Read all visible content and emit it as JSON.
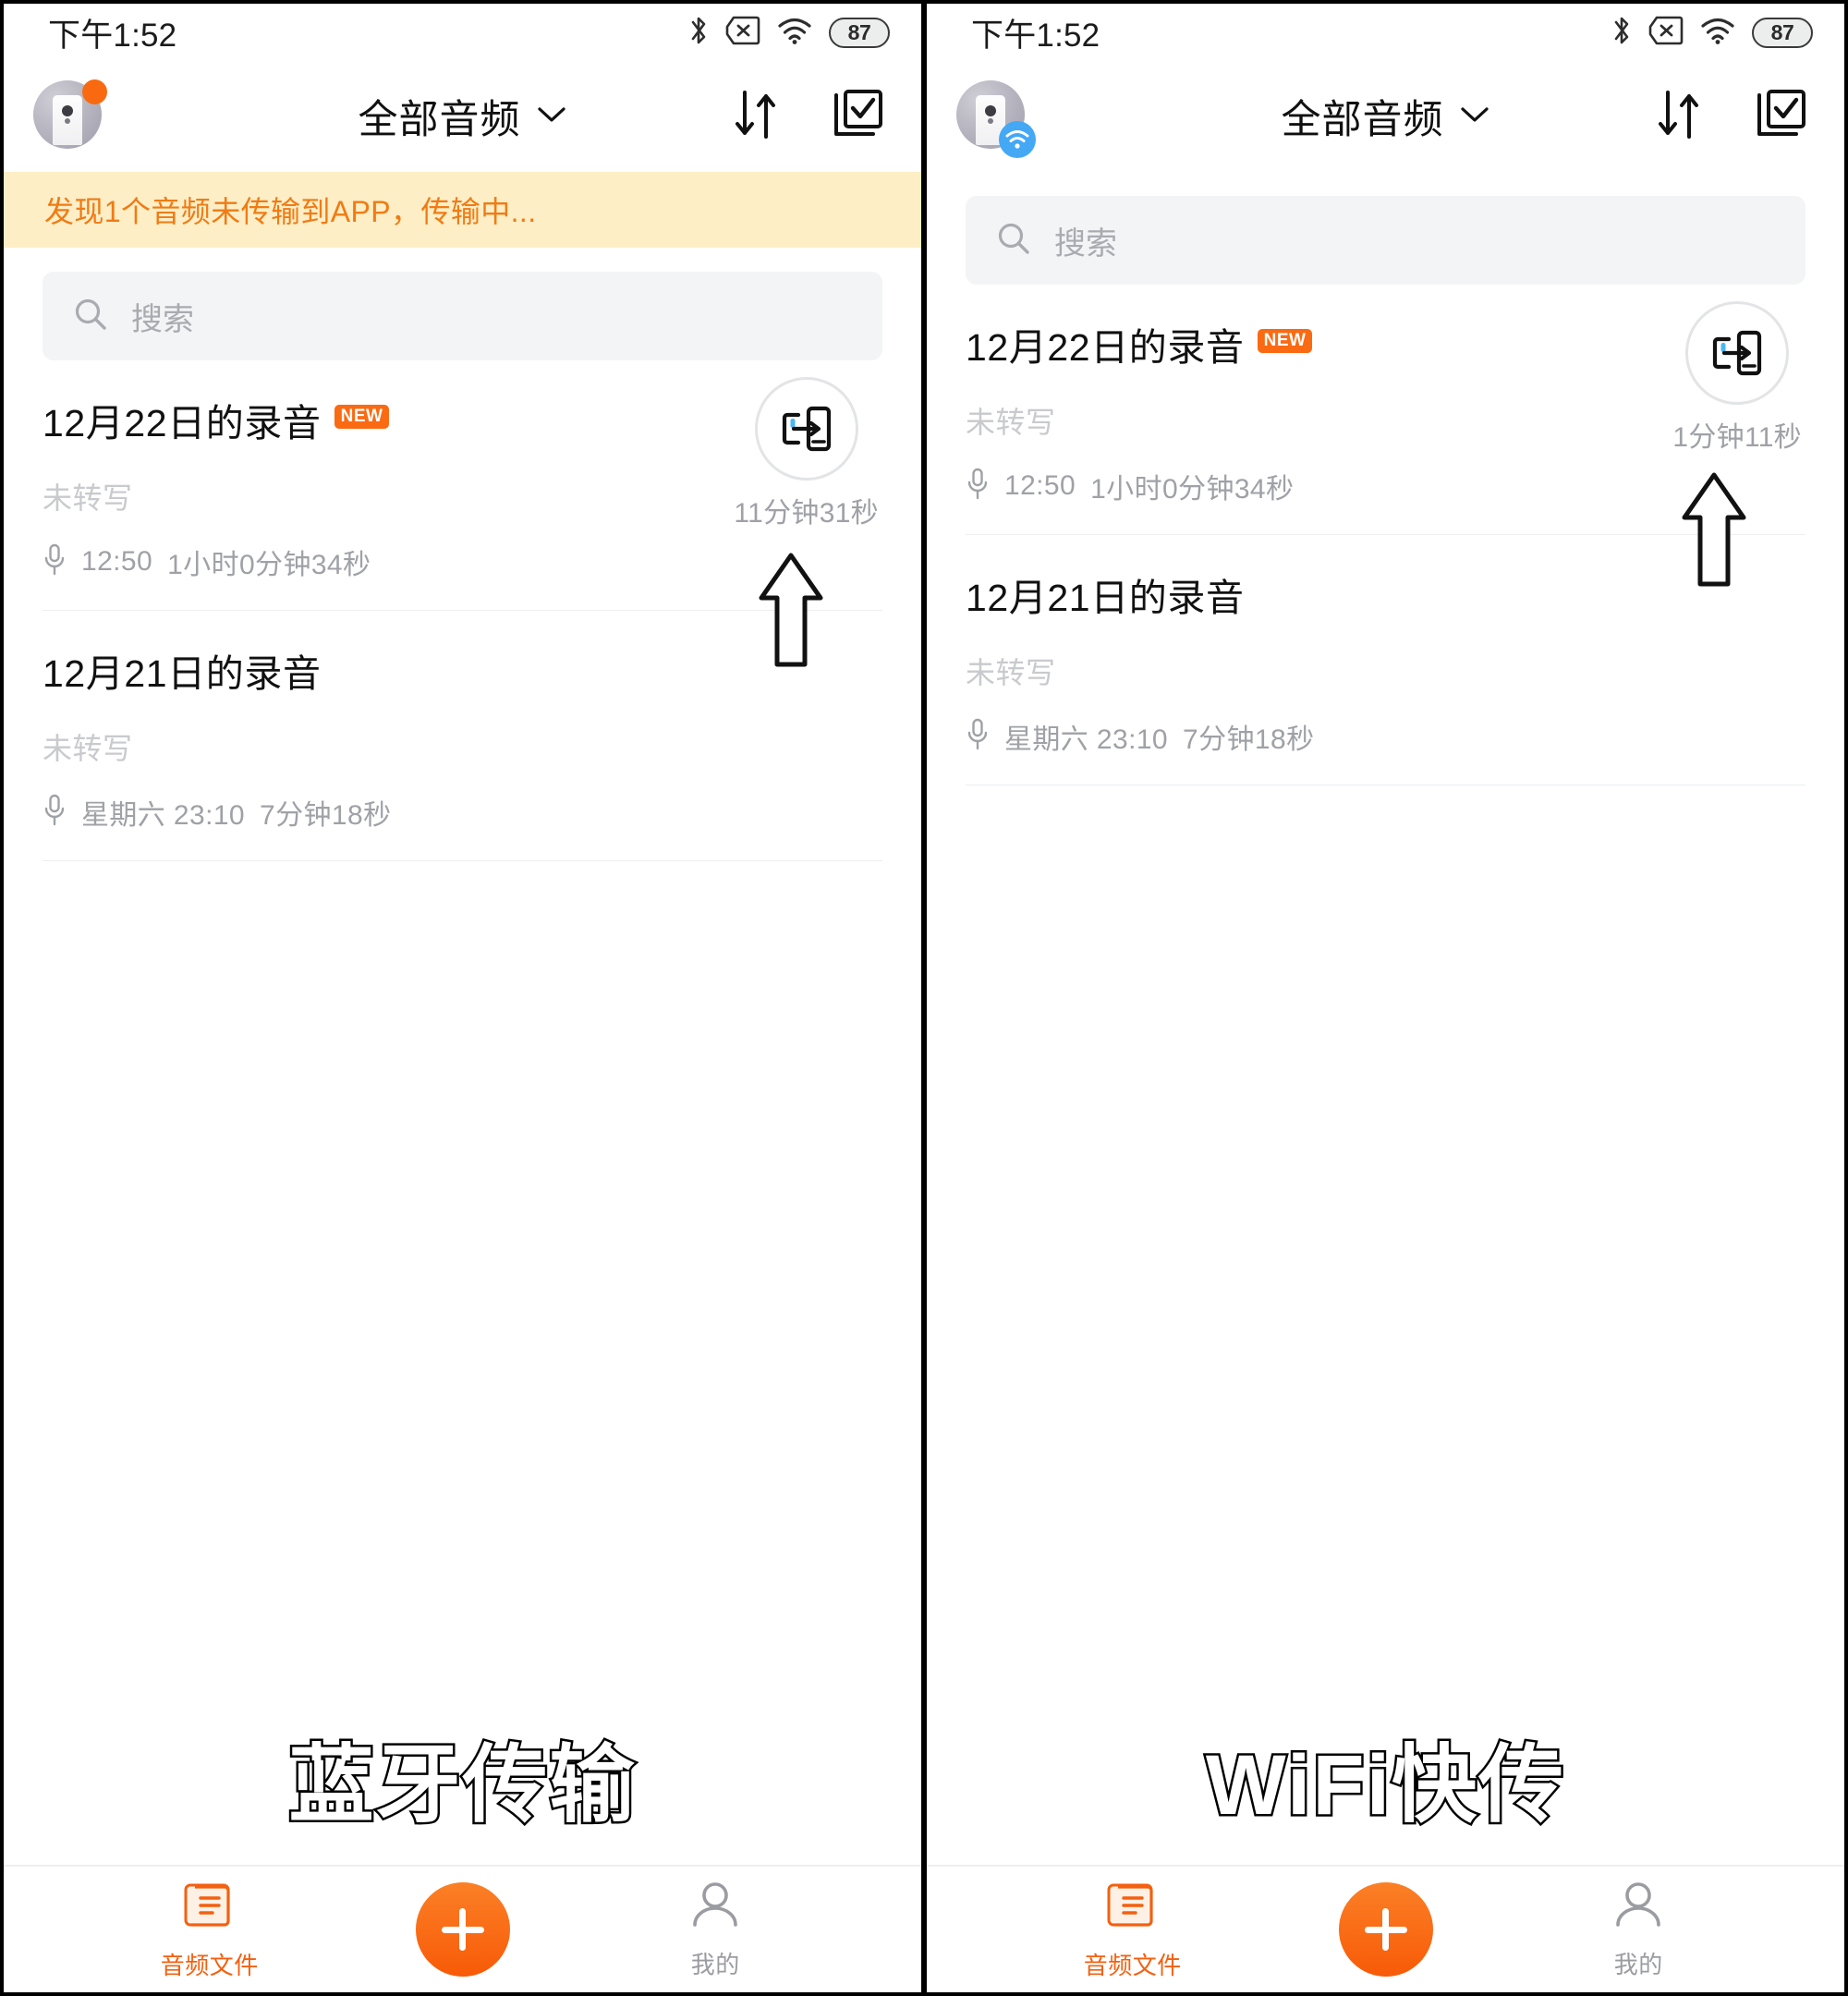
{
  "panels": [
    {
      "id": "bluetooth",
      "statusbar": {
        "time": "下午1:52",
        "battery": "87",
        "icons": [
          "bluetooth-icon",
          "sim-off-icon",
          "wifi-icon",
          "battery-icon"
        ]
      },
      "appbar": {
        "title": "全部音频",
        "avatar_badge": "orange-dot",
        "sort_label": "sort-icon",
        "select_label": "multi-select-icon"
      },
      "notice": {
        "visible": true,
        "text": "发现1个音频未传输到APP，传输中...",
        "color": "#f07b14",
        "bg": "#fdeec6"
      },
      "search": {
        "placeholder": "搜索",
        "value": ""
      },
      "recordings": [
        {
          "title": "12月22日的录音",
          "badge": "NEW",
          "status": "未转写",
          "time": "12:50",
          "duration": "1小时0分钟34秒",
          "transfer_visible": true,
          "transfer_eta": "11分钟31秒"
        },
        {
          "title": "12月21日的录音",
          "badge": "",
          "status": "未转写",
          "time": "星期六 23:10",
          "duration": "7分钟18秒",
          "transfer_visible": false,
          "transfer_eta": ""
        }
      ],
      "caption": "蓝牙传输",
      "tabbar": {
        "tabs": [
          {
            "label": "音频文件",
            "icon": "document-list-icon",
            "active": true
          },
          {
            "label": "我的",
            "icon": "person-icon",
            "active": false
          }
        ],
        "fab": "plus-icon"
      }
    },
    {
      "id": "wifi",
      "statusbar": {
        "time": "下午1:52",
        "battery": "87",
        "icons": [
          "bluetooth-icon",
          "sim-off-icon",
          "wifi-icon",
          "battery-icon"
        ]
      },
      "appbar": {
        "title": "全部音频",
        "avatar_badge": "wifi-badge",
        "sort_label": "sort-icon",
        "select_label": "multi-select-icon"
      },
      "notice": {
        "visible": false,
        "text": "",
        "color": "#f07b14",
        "bg": "#fdeec6"
      },
      "search": {
        "placeholder": "搜索",
        "value": ""
      },
      "recordings": [
        {
          "title": "12月22日的录音",
          "badge": "NEW",
          "status": "未转写",
          "time": "12:50",
          "duration": "1小时0分钟34秒",
          "transfer_visible": true,
          "transfer_eta": "1分钟11秒"
        },
        {
          "title": "12月21日的录音",
          "badge": "",
          "status": "未转写",
          "time": "星期六 23:10",
          "duration": "7分钟18秒",
          "transfer_visible": false,
          "transfer_eta": ""
        }
      ],
      "caption": "WiFi快传",
      "tabbar": {
        "tabs": [
          {
            "label": "音频文件",
            "icon": "document-list-icon",
            "active": true
          },
          {
            "label": "我的",
            "icon": "person-icon",
            "active": false
          }
        ],
        "fab": "plus-icon"
      }
    }
  ],
  "theme": {
    "accent": "#f4600f",
    "notice_bg": "#fdeec6",
    "notice_text": "#f07b14",
    "muted": "#9fa1a6",
    "placeholder": "#c9cacd",
    "wifi_badge": "#44a8f5"
  }
}
